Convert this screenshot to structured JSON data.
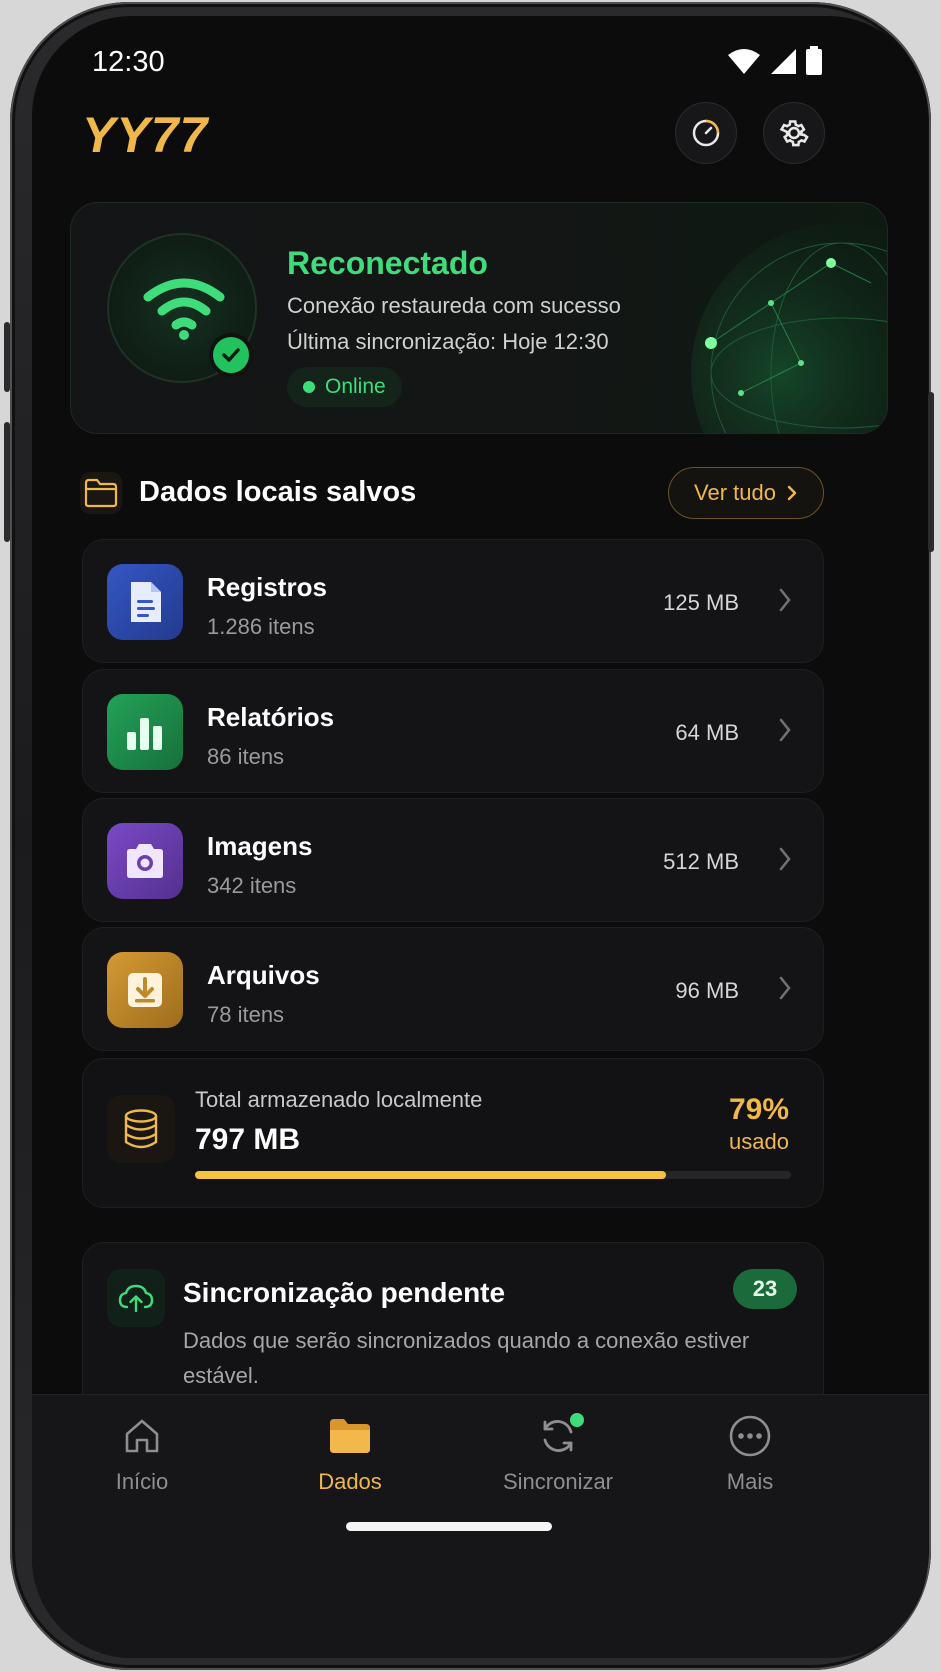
{
  "status_bar": {
    "time": "12:30"
  },
  "header": {
    "logo": "YY77"
  },
  "reconnect": {
    "title": "Reconectado",
    "message": "Conexão restaureda com sucesso",
    "last_sync": "Última sincronização: Hoje 12:30",
    "status_pill": "Online"
  },
  "section": {
    "title": "Dados locais salvos",
    "view_all": "Ver tudo"
  },
  "items": [
    {
      "name": "Registros",
      "count": "1.286 itens",
      "size": "125 MB",
      "icon": "document-icon",
      "color": "#2d4fb6"
    },
    {
      "name": "Relatórios",
      "count": "86 itens",
      "size": "64 MB",
      "icon": "bar-chart-icon",
      "color": "#1f8a4c"
    },
    {
      "name": "Imagens",
      "count": "342 itens",
      "size": "512 MB",
      "icon": "camera-icon",
      "color": "#6a3fb0"
    },
    {
      "name": "Arquivos",
      "count": "78 itens",
      "size": "96 MB",
      "icon": "download-icon",
      "color": "#c2892a"
    }
  ],
  "total": {
    "label": "Total armazenado localmente",
    "value": "797 MB",
    "percent": "79%",
    "used_label": "usado",
    "fill_fraction": 0.79
  },
  "pending": {
    "title": "Sincronização pendente",
    "badge": "23",
    "description": "Dados que serão sincronizados quando a conexão estiver estável."
  },
  "nav": [
    {
      "label": "Início",
      "icon": "home-icon"
    },
    {
      "label": "Dados",
      "icon": "folder-icon",
      "active": true
    },
    {
      "label": "Sincronizar",
      "icon": "sync-icon"
    },
    {
      "label": "Mais",
      "icon": "more-icon"
    }
  ],
  "colors": {
    "accent": "#f0b84a",
    "success": "#3fdc7c",
    "background": "#0c0c0d"
  }
}
